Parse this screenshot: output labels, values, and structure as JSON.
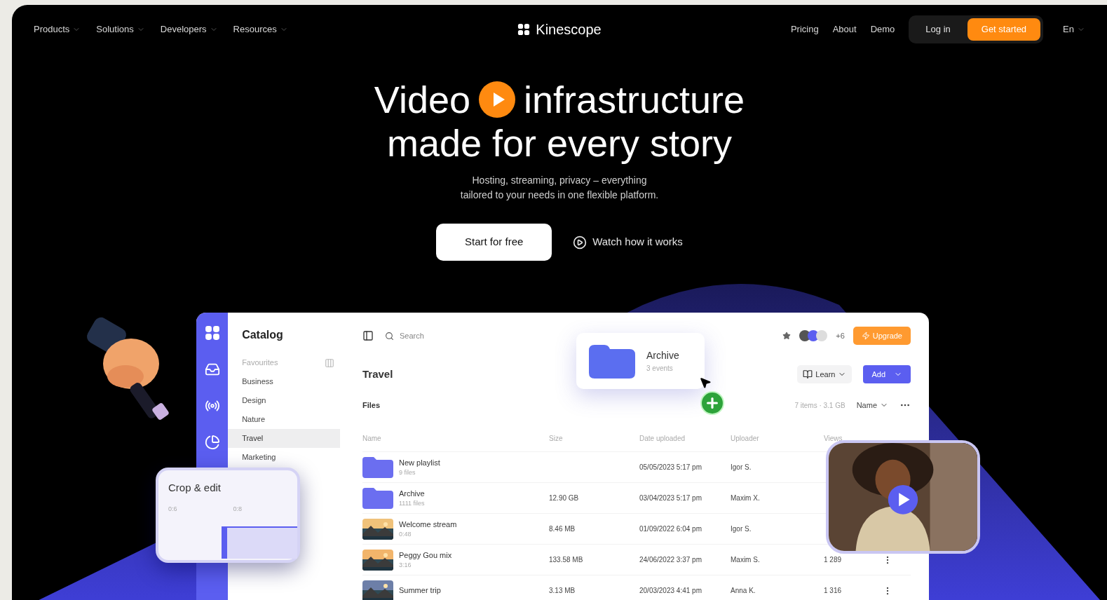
{
  "nav": {
    "menus": [
      "Products",
      "Solutions",
      "Developers",
      "Resources"
    ],
    "logo": "Kinescope",
    "links": [
      "Pricing",
      "About",
      "Demo"
    ],
    "login": "Log in",
    "cta": "Get started",
    "language": "En"
  },
  "hero": {
    "title_start": "Video",
    "title_end": "infrastructure",
    "title_line2": "made for every story",
    "subtitle_lines": [
      "Hosting, streaming, privacy – everything",
      "tailored to your needs in one flexible platform."
    ],
    "primary": "Start for free",
    "secondary": "Watch how it works"
  },
  "dashboard": {
    "catalog": {
      "title": "Catalog",
      "items": [
        {
          "label": "Favourites",
          "selected": false,
          "kind": "pinned"
        },
        {
          "label": "Business",
          "selected": false,
          "kind": "folder"
        },
        {
          "label": "Design",
          "selected": false,
          "kind": "folder"
        },
        {
          "label": "Nature",
          "selected": false,
          "kind": "folder"
        },
        {
          "label": "Travel",
          "selected": true,
          "kind": "folder"
        },
        {
          "label": "Marketing",
          "selected": false,
          "kind": "folder"
        }
      ]
    },
    "search": {
      "placeholder": "Search"
    },
    "members_extra": "+6",
    "upgrade": "Upgrade",
    "folder_title": "Travel",
    "learn": "Learn",
    "add": "Add",
    "section": "Files",
    "summary": "7 items · 3.1 GB",
    "sort": "Name",
    "table": {
      "columns": [
        "Name",
        "Size",
        "Date uploaded",
        "Uploader",
        "Views"
      ],
      "rows": [
        {
          "kind": "folder",
          "name": "New playlist",
          "meta": "9 files",
          "date": "05/05/2023 5:17 pm",
          "uploader": "Igor S."
        },
        {
          "kind": "folder",
          "name": "Archive",
          "meta": "1111 files",
          "size": "12.90 GB",
          "date": "03/04/2023 5:17 pm",
          "uploader": "Maxim X."
        },
        {
          "kind": "video",
          "name": "Welcome stream",
          "meta": "0:48",
          "size": "8.46 MB",
          "date": "01/09/2022 6:04 pm",
          "uploader": "Igor S."
        },
        {
          "kind": "video",
          "name": "Peggy Gou mix",
          "meta": "3:16",
          "size": "133.58 MB",
          "date": "24/06/2022 3:37 pm",
          "uploader": "Maxim S.",
          "views": "1 289",
          "actions": true
        },
        {
          "kind": "video",
          "name": "Summer trip",
          "size": "3.13 MB",
          "date": "20/03/2023 4:41 pm",
          "uploader": "Anna K.",
          "views": "1 316",
          "actions": true
        }
      ]
    }
  },
  "archive_popup": {
    "title": "Archive",
    "meta": "3 events"
  },
  "crop_card": {
    "title": "Crop & edit",
    "labels": [
      "0:6",
      "0:8"
    ]
  }
}
